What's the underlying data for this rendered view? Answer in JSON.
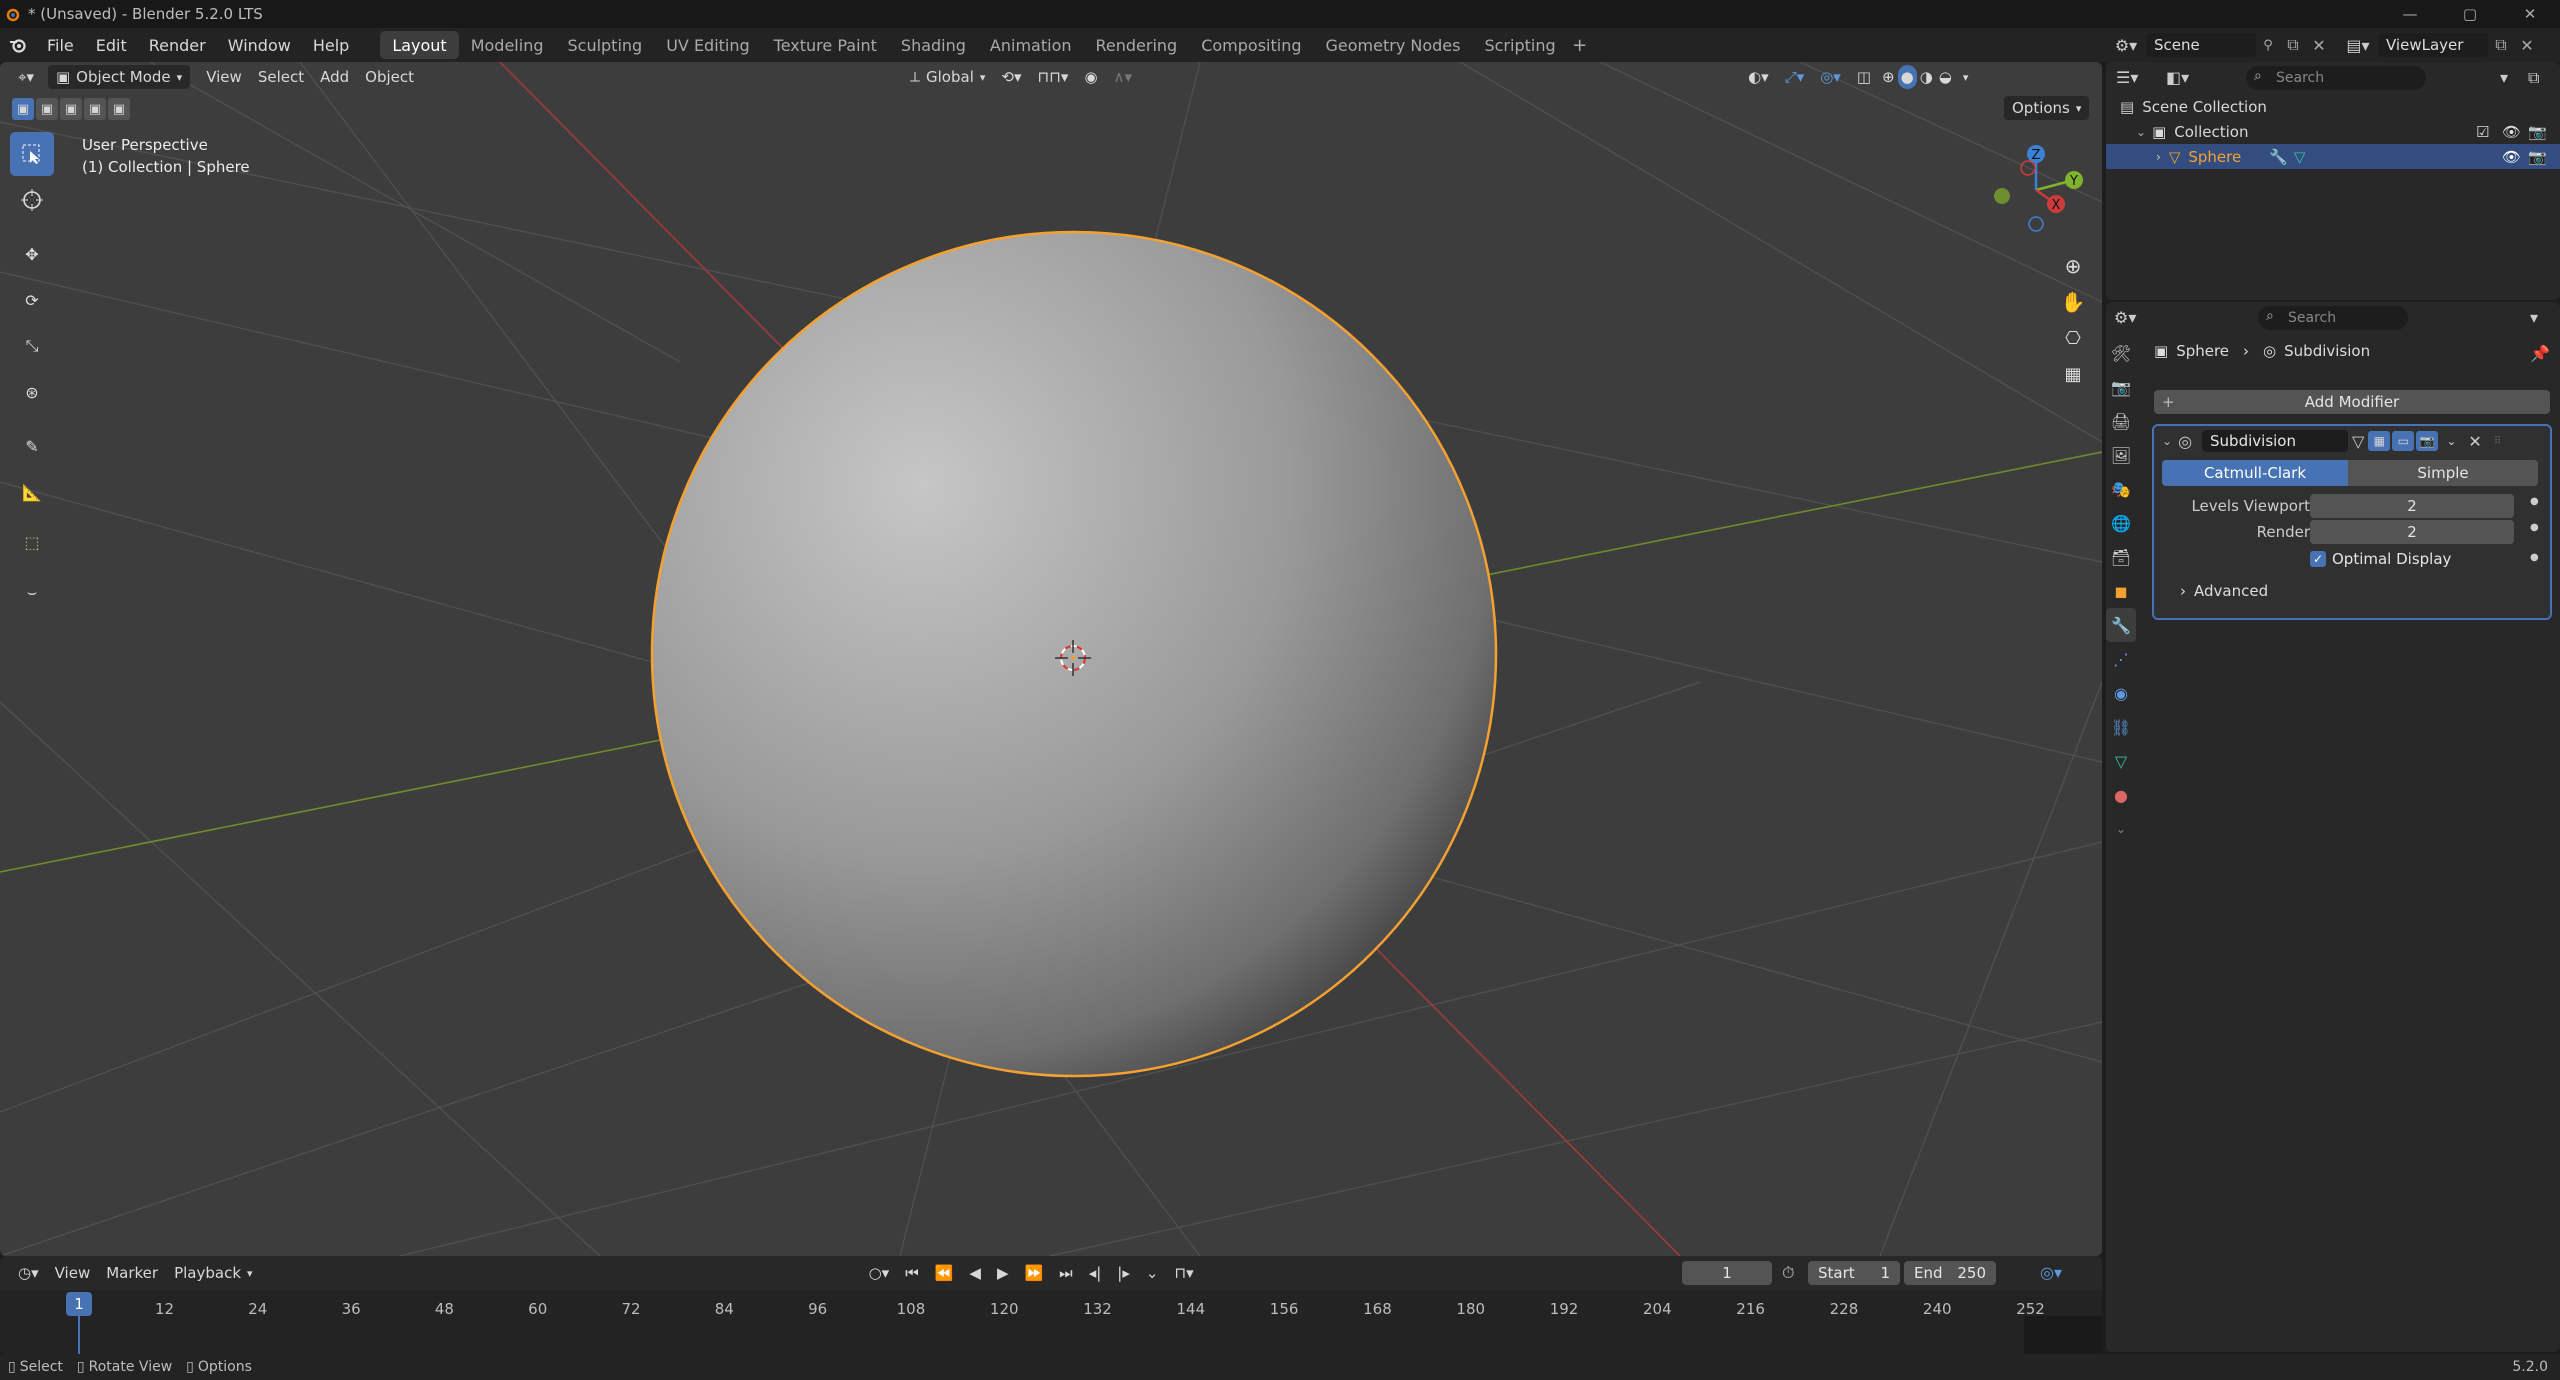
{
  "app": {
    "title": "* (Unsaved) - Blender 5.2.0 LTS",
    "version": "5.2.0"
  },
  "menu": [
    "File",
    "Edit",
    "Render",
    "Window",
    "Help"
  ],
  "workspaces": {
    "active": "Layout",
    "tabs": [
      "Layout",
      "Modeling",
      "Sculpting",
      "UV Editing",
      "Texture Paint",
      "Shading",
      "Animation",
      "Rendering",
      "Compositing",
      "Geometry Nodes",
      "Scripting"
    ]
  },
  "scene": {
    "name": "Scene",
    "view_layer": "ViewLayer"
  },
  "viewport": {
    "mode": "Object Mode",
    "menus": [
      "View",
      "Select",
      "Add",
      "Object"
    ],
    "transform_orientation": "Global",
    "options_label": "Options",
    "overlay_line1": "User Perspective",
    "overlay_line2": "(1) Collection | Sphere",
    "gizmo_labels": {
      "x": "X",
      "y": "Y",
      "z": "Z"
    }
  },
  "outliner": {
    "search_placeholder": "Search",
    "scene_collection": "Scene Collection",
    "collection": "Collection",
    "object": "Sphere"
  },
  "properties": {
    "search_placeholder": "Search",
    "breadcrumb_object": "Sphere",
    "breadcrumb_modifier": "Subdivision",
    "add_modifier_label": "Add Modifier",
    "modifier": {
      "name": "Subdivision",
      "type_options": [
        "Catmull-Clark",
        "Simple"
      ],
      "selected_type": "Catmull-Clark",
      "levels_viewport_label": "Levels Viewport",
      "levels_viewport": "2",
      "render_label": "Render",
      "render": "2",
      "optimal_display_label": "Optimal Display",
      "optimal_display": true,
      "advanced_label": "Advanced"
    }
  },
  "timeline": {
    "menus": [
      "View",
      "Marker",
      "Playback"
    ],
    "current_frame": "1",
    "start_label": "Start",
    "start": "1",
    "end_label": "End",
    "end": "250",
    "ticks": [
      "1",
      "12",
      "24",
      "36",
      "48",
      "60",
      "72",
      "84",
      "96",
      "108",
      "120",
      "132",
      "144",
      "156",
      "168",
      "180",
      "192",
      "204",
      "216",
      "228",
      "240",
      "252"
    ]
  },
  "statusbar": {
    "select": "Select",
    "rotate_view": "Rotate View",
    "options": "Options"
  },
  "colors": {
    "accent": "#4772b3",
    "selection_outline": "#f5a132",
    "axis_x": "#cc3b3b",
    "axis_y": "#7fb32d",
    "axis_z": "#3b82d6"
  }
}
